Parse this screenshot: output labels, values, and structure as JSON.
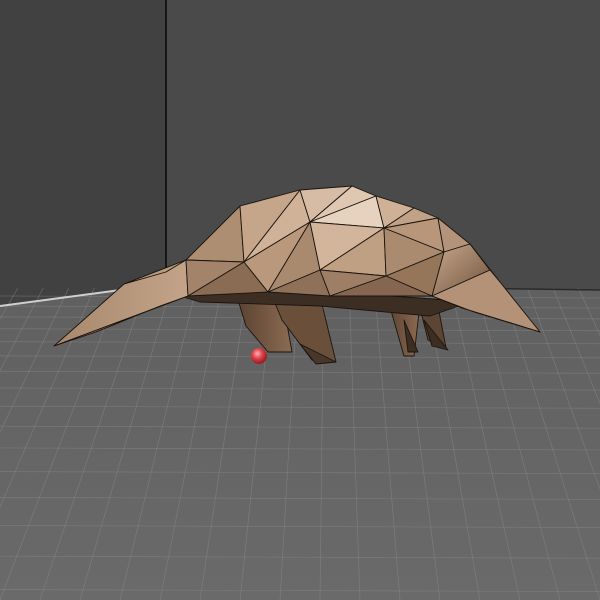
{
  "viewport": {
    "kind": "3d-scene-view",
    "colors": {
      "back_wall": "#4a4a4a",
      "side_wall": "#3f3f3f",
      "floor": "#656565",
      "grid_line": "#8c8c8c",
      "wall_edge": "#161616",
      "mesh_fill": "#a98a6f",
      "mesh_edge": "#1a140f",
      "marker": "#e0454c"
    }
  },
  "scene": {
    "model": {
      "name": "low-poly-anteater",
      "shading": "smooth",
      "wireframe_overlay": true
    },
    "marker": {
      "type": "sphere",
      "color": "#e0454c"
    }
  }
}
